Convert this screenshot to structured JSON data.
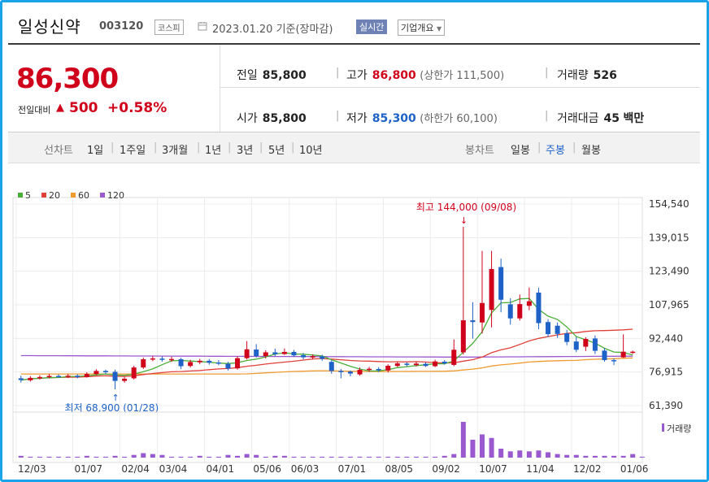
{
  "header": {
    "name": "일성신약",
    "code": "003120",
    "market": "코스피",
    "date": "2023.01.20 기준(장마감)",
    "realtime": "실시간",
    "company_overview": "기업개요"
  },
  "price": {
    "current": "86,300",
    "prev_label": "전일대비",
    "direction_icon": "up-triangle",
    "change": "500",
    "change_pct": "+0.58%",
    "up_color": "#d0021b",
    "down_color": "#1e62c7"
  },
  "stats": {
    "prev_close_label": "전일",
    "prev_close": "85,800",
    "high_label": "고가",
    "high": "86,800",
    "upper_limit": "(상한가 111,500)",
    "volume_label": "거래량",
    "volume": "526",
    "open_label": "시가",
    "open": "85,800",
    "low_label": "저가",
    "low": "85,300",
    "lower_limit": "(하한가 60,100)",
    "value_label": "거래대금",
    "value": "45",
    "value_unit": "백만"
  },
  "periods": {
    "line_label": "선차트",
    "line_items": [
      "1일",
      "1주일",
      "3개월",
      "1년",
      "3년",
      "5년",
      "10년"
    ],
    "candle_label": "봉차트",
    "candle_items": [
      "일봉",
      "주봉",
      "월봉"
    ],
    "active_candle": "주봉",
    "active_color": "#1e62c7"
  },
  "chart_data": {
    "type": "candlestick",
    "legend": [
      {
        "name": "5",
        "color": "#4cae3a"
      },
      {
        "name": "20",
        "color": "#e0403a"
      },
      {
        "name": "60",
        "color": "#f09a2e"
      },
      {
        "name": "120",
        "color": "#9b59d0"
      }
    ],
    "y_ticks": [
      "154,540",
      "139,015",
      "123,490",
      "107,965",
      "92,440",
      "76,915",
      "61,390"
    ],
    "ylim": [
      61390,
      154540
    ],
    "x_ticks": [
      "12/03",
      "01/07",
      "02/04",
      "03/04",
      "04/01",
      "05/06",
      "06/03",
      "07/01",
      "08/05",
      "09/02",
      "10/07",
      "11/04",
      "12/02",
      "01/06"
    ],
    "max_annotation": "최고 144,000 (09/08)",
    "min_annotation": "최저 68,900 (01/28)",
    "volume_legend": "거래량",
    "candles": [
      {
        "o": 74000,
        "c": 73200,
        "h": 75200,
        "l": 72000
      },
      {
        "o": 73100,
        "c": 74200,
        "h": 75000,
        "l": 72500
      },
      {
        "o": 74000,
        "c": 74600,
        "h": 75400,
        "l": 73400
      },
      {
        "o": 74600,
        "c": 75100,
        "h": 76000,
        "l": 74000
      },
      {
        "o": 75100,
        "c": 74800,
        "h": 75800,
        "l": 74200
      },
      {
        "o": 74700,
        "c": 75200,
        "h": 76000,
        "l": 74200
      },
      {
        "o": 75200,
        "c": 74600,
        "h": 75900,
        "l": 74000
      },
      {
        "o": 74600,
        "c": 76000,
        "h": 76800,
        "l": 74300
      },
      {
        "o": 76000,
        "c": 77400,
        "h": 78200,
        "l": 75500
      },
      {
        "o": 77400,
        "c": 76800,
        "h": 78000,
        "l": 76000
      },
      {
        "o": 77000,
        "c": 72800,
        "h": 78000,
        "l": 68900
      },
      {
        "o": 72800,
        "c": 73800,
        "h": 74600,
        "l": 72000
      },
      {
        "o": 74000,
        "c": 79000,
        "h": 79800,
        "l": 73500
      },
      {
        "o": 79000,
        "c": 82800,
        "h": 83600,
        "l": 78300
      },
      {
        "o": 82800,
        "c": 83200,
        "h": 84200,
        "l": 81900
      },
      {
        "o": 83100,
        "c": 82600,
        "h": 84100,
        "l": 81700
      },
      {
        "o": 82500,
        "c": 82900,
        "h": 84000,
        "l": 81600
      },
      {
        "o": 82800,
        "c": 79600,
        "h": 83500,
        "l": 78300
      },
      {
        "o": 79700,
        "c": 81500,
        "h": 82600,
        "l": 79000
      },
      {
        "o": 81400,
        "c": 82100,
        "h": 83000,
        "l": 80500
      },
      {
        "o": 82100,
        "c": 81200,
        "h": 82900,
        "l": 80300
      },
      {
        "o": 81300,
        "c": 80800,
        "h": 82400,
        "l": 80000
      },
      {
        "o": 80700,
        "c": 78500,
        "h": 81600,
        "l": 77600
      },
      {
        "o": 78600,
        "c": 83300,
        "h": 84200,
        "l": 78000
      },
      {
        "o": 83300,
        "c": 87400,
        "h": 91200,
        "l": 82700
      },
      {
        "o": 87300,
        "c": 84300,
        "h": 89800,
        "l": 83600
      },
      {
        "o": 84300,
        "c": 86000,
        "h": 86900,
        "l": 83200
      },
      {
        "o": 86000,
        "c": 85100,
        "h": 87700,
        "l": 84200
      },
      {
        "o": 85200,
        "c": 86200,
        "h": 87800,
        "l": 84800
      },
      {
        "o": 86200,
        "c": 84600,
        "h": 87100,
        "l": 83900
      },
      {
        "o": 84700,
        "c": 83700,
        "h": 85700,
        "l": 82800
      },
      {
        "o": 83600,
        "c": 84200,
        "h": 85000,
        "l": 82700
      },
      {
        "o": 84100,
        "c": 83000,
        "h": 84900,
        "l": 82100
      },
      {
        "o": 81600,
        "c": 77400,
        "h": 82400,
        "l": 76100
      },
      {
        "o": 77400,
        "c": 77000,
        "h": 78300,
        "l": 74000
      },
      {
        "o": 77100,
        "c": 76200,
        "h": 77600,
        "l": 74900
      },
      {
        "o": 75800,
        "c": 77900,
        "h": 79000,
        "l": 75200
      },
      {
        "o": 77900,
        "c": 78400,
        "h": 79300,
        "l": 77000
      },
      {
        "o": 78300,
        "c": 77700,
        "h": 79200,
        "l": 76900
      },
      {
        "o": 77600,
        "c": 79800,
        "h": 80500,
        "l": 76700
      },
      {
        "o": 79700,
        "c": 80900,
        "h": 81700,
        "l": 79200
      },
      {
        "o": 80800,
        "c": 80200,
        "h": 81400,
        "l": 79500
      },
      {
        "o": 80100,
        "c": 80800,
        "h": 81600,
        "l": 79500
      },
      {
        "o": 80700,
        "c": 79700,
        "h": 81300,
        "l": 79200
      },
      {
        "o": 79600,
        "c": 81800,
        "h": 82600,
        "l": 79200
      },
      {
        "o": 81700,
        "c": 80900,
        "h": 82400,
        "l": 80300
      },
      {
        "o": 80200,
        "c": 87200,
        "h": 92000,
        "l": 79600
      },
      {
        "o": 86000,
        "c": 100800,
        "h": 144000,
        "l": 85000
      },
      {
        "o": 100800,
        "c": 100000,
        "h": 109200,
        "l": 92300
      },
      {
        "o": 99800,
        "c": 108800,
        "h": 132900,
        "l": 94700
      },
      {
        "o": 105600,
        "c": 124500,
        "h": 132900,
        "l": 97500
      },
      {
        "o": 125400,
        "c": 110300,
        "h": 129300,
        "l": 104500
      },
      {
        "o": 108200,
        "c": 101700,
        "h": 111000,
        "l": 98800
      },
      {
        "o": 101700,
        "c": 108300,
        "h": 112700,
        "l": 100700
      },
      {
        "o": 107500,
        "c": 109600,
        "h": 116000,
        "l": 105500
      },
      {
        "o": 113600,
        "c": 99500,
        "h": 115800,
        "l": 96700
      },
      {
        "o": 100000,
        "c": 94400,
        "h": 101300,
        "l": 93100
      },
      {
        "o": 98300,
        "c": 94500,
        "h": 99800,
        "l": 92700
      },
      {
        "o": 94800,
        "c": 90800,
        "h": 96400,
        "l": 89300
      },
      {
        "o": 91000,
        "c": 87200,
        "h": 93200,
        "l": 86100
      },
      {
        "o": 88600,
        "c": 92200,
        "h": 93000,
        "l": 86600
      },
      {
        "o": 92400,
        "c": 86700,
        "h": 93800,
        "l": 85200
      },
      {
        "o": 86800,
        "c": 82400,
        "h": 88000,
        "l": 81700
      },
      {
        "o": 82400,
        "c": 82200,
        "h": 83200,
        "l": 80100
      },
      {
        "o": 83700,
        "c": 86300,
        "h": 94300,
        "l": 83400
      },
      {
        "o": 85800,
        "c": 86300,
        "h": 86800,
        "l": 85300
      }
    ],
    "volume_bars": [
      2,
      1,
      1,
      1,
      1,
      1,
      1,
      2,
      1,
      1,
      2,
      1,
      3,
      5,
      4,
      3,
      1,
      1,
      1,
      2,
      1,
      1,
      3,
      2,
      4,
      3,
      1,
      2,
      2,
      1,
      1,
      1,
      1,
      1,
      1,
      1,
      1,
      1,
      1,
      1,
      1,
      1,
      1,
      1,
      1,
      2,
      4,
      40,
      20,
      26,
      22,
      10,
      7,
      8,
      7,
      8,
      6,
      4,
      3,
      3,
      2,
      2,
      2,
      2,
      2,
      4,
      1
    ]
  }
}
